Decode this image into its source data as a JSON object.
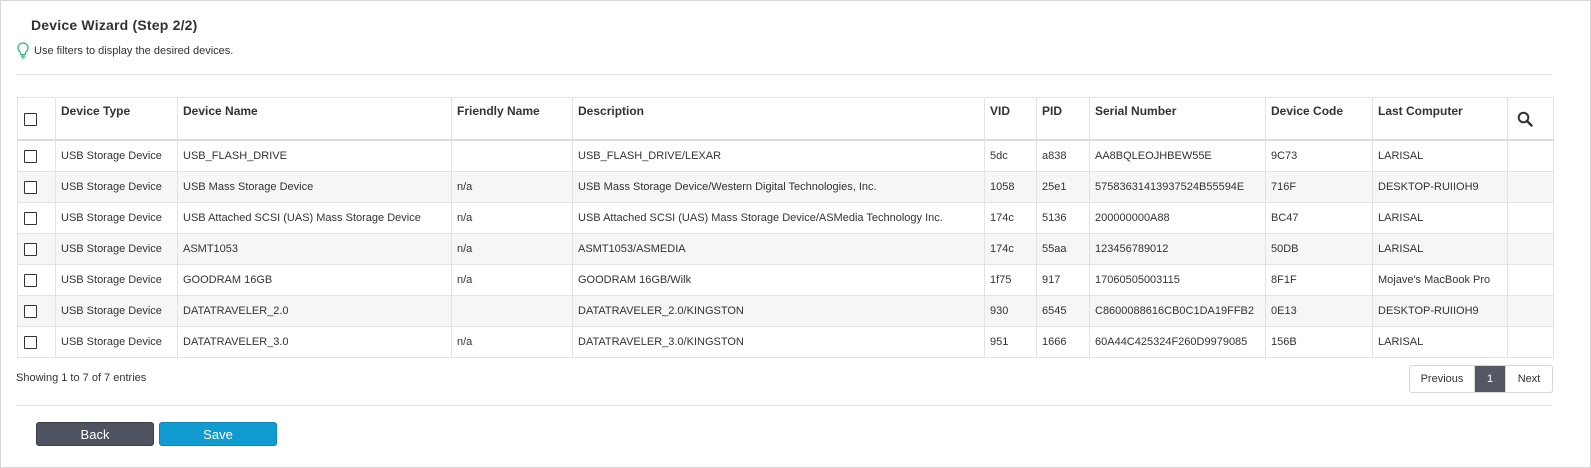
{
  "wizard": {
    "title": "Device Wizard (Step 2/2)",
    "hint": "Use filters to display the desired devices."
  },
  "table": {
    "columns": [
      "Device Type",
      "Device Name",
      "Friendly Name",
      "Description",
      "VID",
      "PID",
      "Serial Number",
      "Device Code",
      "Last Computer"
    ],
    "rows": [
      {
        "type": "USB Storage Device",
        "name": "USB_FLASH_DRIVE",
        "friendly": "",
        "description": "USB_FLASH_DRIVE/LEXAR",
        "vid": "5dc",
        "pid": "a838",
        "serial": "AA8BQLEOJHBEW55E",
        "code": "9C73",
        "computer": "LARISAL"
      },
      {
        "type": "USB Storage Device",
        "name": "USB Mass Storage Device",
        "friendly": "n/a",
        "description": "USB Mass Storage Device/Western Digital Technologies, Inc.",
        "vid": "1058",
        "pid": "25e1",
        "serial": "57583631413937524B55594E",
        "code": "716F",
        "computer": "DESKTOP-RUIIOH9"
      },
      {
        "type": "USB Storage Device",
        "name": "USB Attached SCSI (UAS) Mass Storage Device",
        "friendly": "n/a",
        "description": "USB Attached SCSI (UAS) Mass Storage Device/ASMedia Technology Inc.",
        "vid": "174c",
        "pid": "5136",
        "serial": "200000000A88",
        "code": "BC47",
        "computer": "LARISAL"
      },
      {
        "type": "USB Storage Device",
        "name": "ASMT1053",
        "friendly": "n/a",
        "description": "ASMT1053/ASMEDIA",
        "vid": "174c",
        "pid": "55aa",
        "serial": "123456789012",
        "code": "50DB",
        "computer": "LARISAL"
      },
      {
        "type": "USB Storage Device",
        "name": "GOODRAM 16GB",
        "friendly": "n/a",
        "description": "GOODRAM 16GB/Wilk",
        "vid": "1f75",
        "pid": "917",
        "serial": "17060505003115",
        "code": "8F1F",
        "computer": "Mojave's MacBook Pro"
      },
      {
        "type": "USB Storage Device",
        "name": "DATATRAVELER_2.0",
        "friendly": "",
        "description": "DATATRAVELER_2.0/KINGSTON",
        "vid": "930",
        "pid": "6545",
        "serial": "C8600088616CB0C1DA19FFB2",
        "code": "0E13",
        "computer": "DESKTOP-RUIIOH9"
      },
      {
        "type": "USB Storage Device",
        "name": "DATATRAVELER_3.0",
        "friendly": "n/a",
        "description": "DATATRAVELER_3.0/KINGSTON",
        "vid": "951",
        "pid": "1666",
        "serial": "60A44C425324F260D9979085",
        "code": "156B",
        "computer": "LARISAL"
      }
    ]
  },
  "footer": {
    "info": "Showing 1 to 7 of 7 entries",
    "pagination": {
      "previous": "Previous",
      "current": "1",
      "next": "Next"
    }
  },
  "buttons": {
    "back": "Back",
    "save": "Save"
  },
  "colors": {
    "save": "#109bd1",
    "back": "#4f5260",
    "hint_icon": "#3cb878",
    "current_page": "#545863"
  },
  "icons": {
    "hint": "lightbulb-icon",
    "search": "search-icon"
  }
}
